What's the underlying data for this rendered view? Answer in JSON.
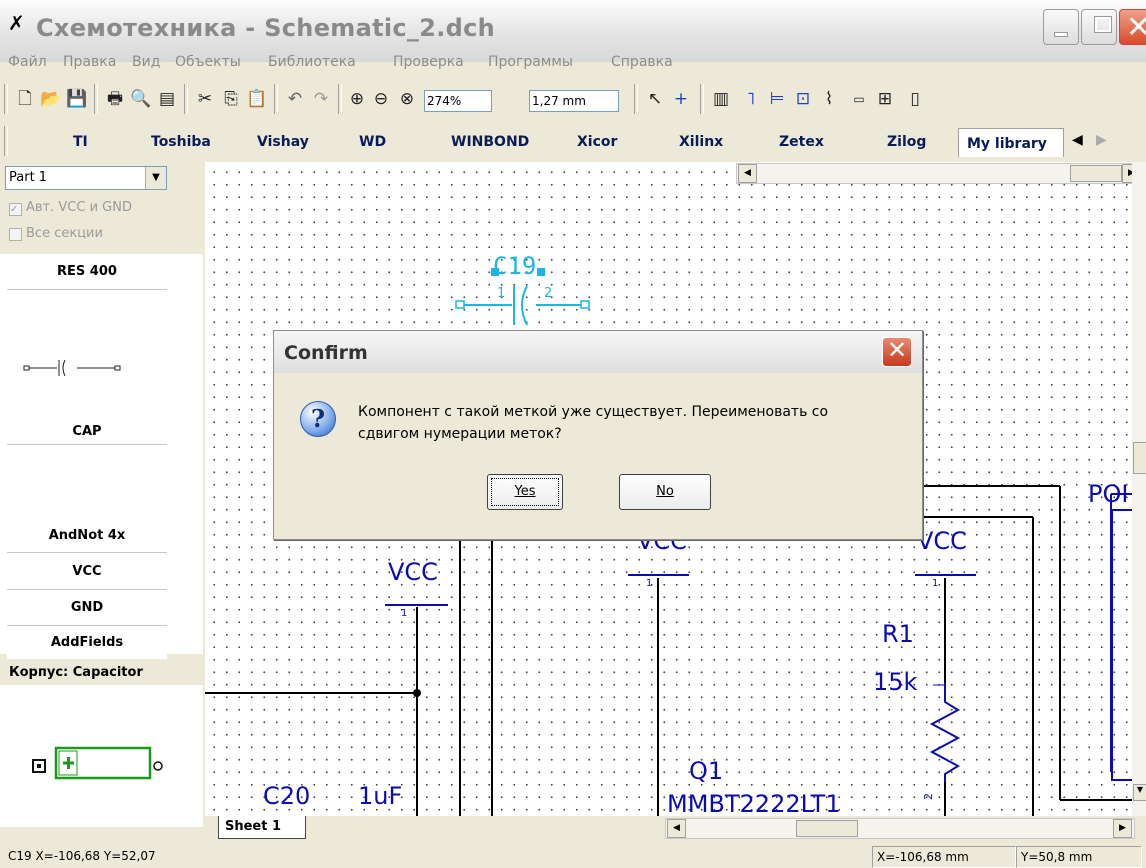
{
  "window": {
    "title": "Схемотехника - Schematic_2.dch"
  },
  "menu": [
    "Файл",
    "Правка",
    "Вид",
    "Объекты",
    "Библиотека",
    "Проверка",
    "Программы",
    "Справка"
  ],
  "toolbar": {
    "zoom_value": "274%",
    "grid_value": "1,27 mm"
  },
  "library_tabs": [
    "TI",
    "Toshiba",
    "Vishay",
    "WD",
    "WINBOND",
    "Xicor",
    "Xilinx",
    "Zetex",
    "Zilog",
    "My library"
  ],
  "left_panel": {
    "part_select": "Part 1",
    "auto_vcc_label": "Авт. VCC и GND",
    "all_sections_label": "Все секции",
    "components": [
      "RES 400",
      "CAP",
      "AndNot 4x",
      "VCC",
      "GND",
      "AddFields"
    ],
    "package_label": "Корпус: Capacitor"
  },
  "schematic": {
    "c19_label": "C19",
    "c19_pin1": "1",
    "c19_pin2": "2",
    "vcc_labels": [
      "VCC",
      "VCC",
      "VCC"
    ],
    "r1_label": "R1",
    "r1_value": "15k",
    "r1_pin": "2",
    "q1_label": "Q1",
    "q1_value": "MMBT2222LT1",
    "c20_label": "C20",
    "c20_value": "1uF",
    "port_label": "POI",
    "vcc_pin": "1"
  },
  "sheet_tab": "Sheet 1",
  "dialog": {
    "title": "Confirm",
    "message_line1": "Компонент с такой меткой уже существует. Переименовать со",
    "message_line2": "сдвигом нумерации меток?",
    "yes_label": "Yes",
    "no_label": "No"
  },
  "status_bar": {
    "left": "C19  X=-106,68  Y=52,07",
    "x": "X=-106,68 mm",
    "y": "Y=50,8 mm"
  },
  "colors": {
    "schematic_blue": "#0b0bb0",
    "selected_cyan": "#1ab6e8",
    "package_green": "#1a9a1a"
  }
}
